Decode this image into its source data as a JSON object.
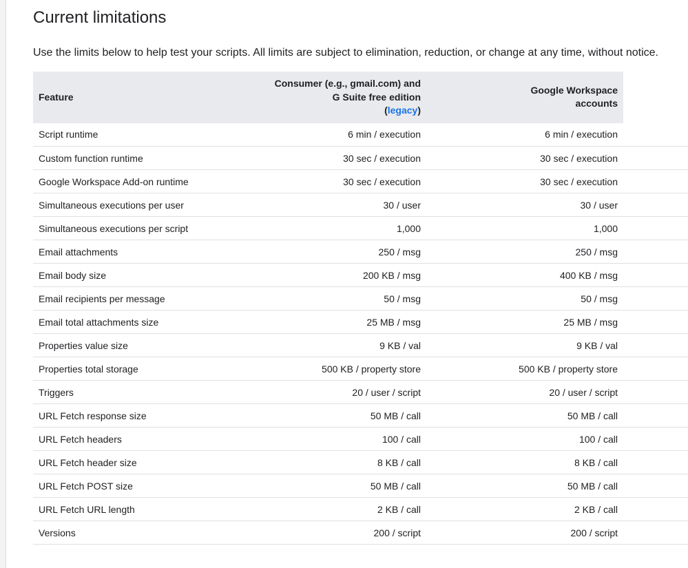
{
  "page": {
    "title": "Current limitations",
    "intro": "Use the limits below to help test your scripts. All limits are subject to elimination, reduction, or change at any time, without notice."
  },
  "table": {
    "headers": {
      "feature": "Feature",
      "consumer_line1": "Consumer (e.g., gmail.com) and",
      "consumer_line2": "G Suite free edition",
      "consumer_paren_open": "(",
      "consumer_link": "legacy",
      "consumer_paren_close": ")",
      "workspace_line1": "Google Workspace",
      "workspace_line2": "accounts"
    },
    "rows": [
      {
        "feature": "Script runtime",
        "consumer": "6 min / execution",
        "workspace": "6 min / execution"
      },
      {
        "feature": "Custom function runtime",
        "consumer": "30 sec / execution",
        "workspace": "30 sec / execution"
      },
      {
        "feature": "Google Workspace Add-on runtime",
        "consumer": "30 sec / execution",
        "workspace": "30 sec / execution"
      },
      {
        "feature": "Simultaneous executions per user",
        "consumer": "30 / user",
        "workspace": "30 / user"
      },
      {
        "feature": "Simultaneous executions per script",
        "consumer": "1,000",
        "workspace": "1,000"
      },
      {
        "feature": "Email attachments",
        "consumer": "250 / msg",
        "workspace": "250 / msg"
      },
      {
        "feature": "Email body size",
        "consumer": "200 KB / msg",
        "workspace": "400 KB / msg"
      },
      {
        "feature": "Email recipients per message",
        "consumer": "50 / msg",
        "workspace": "50 / msg"
      },
      {
        "feature": "Email total attachments size",
        "consumer": "25 MB / msg",
        "workspace": "25 MB / msg"
      },
      {
        "feature": "Properties value size",
        "consumer": "9 KB / val",
        "workspace": "9 KB / val"
      },
      {
        "feature": "Properties total storage",
        "consumer": "500 KB / property store",
        "workspace": "500 KB / property store"
      },
      {
        "feature": "Triggers",
        "consumer": "20 / user / script",
        "workspace": "20 / user / script"
      },
      {
        "feature": "URL Fetch response size",
        "consumer": "50 MB / call",
        "workspace": "50 MB / call"
      },
      {
        "feature": "URL Fetch headers",
        "consumer": "100 / call",
        "workspace": "100 / call"
      },
      {
        "feature": "URL Fetch header size",
        "consumer": "8 KB / call",
        "workspace": "8 KB / call"
      },
      {
        "feature": "URL Fetch POST size",
        "consumer": "50 MB / call",
        "workspace": "50 MB / call"
      },
      {
        "feature": "URL Fetch URL length",
        "consumer": "2 KB / call",
        "workspace": "2 KB / call"
      },
      {
        "feature": "Versions",
        "consumer": "200 / script",
        "workspace": "200 / script"
      }
    ]
  },
  "colors": {
    "header_bg": "#e8eaed",
    "link": "#1a73e8",
    "row_border": "#e0e0e0",
    "text": "#202124"
  }
}
